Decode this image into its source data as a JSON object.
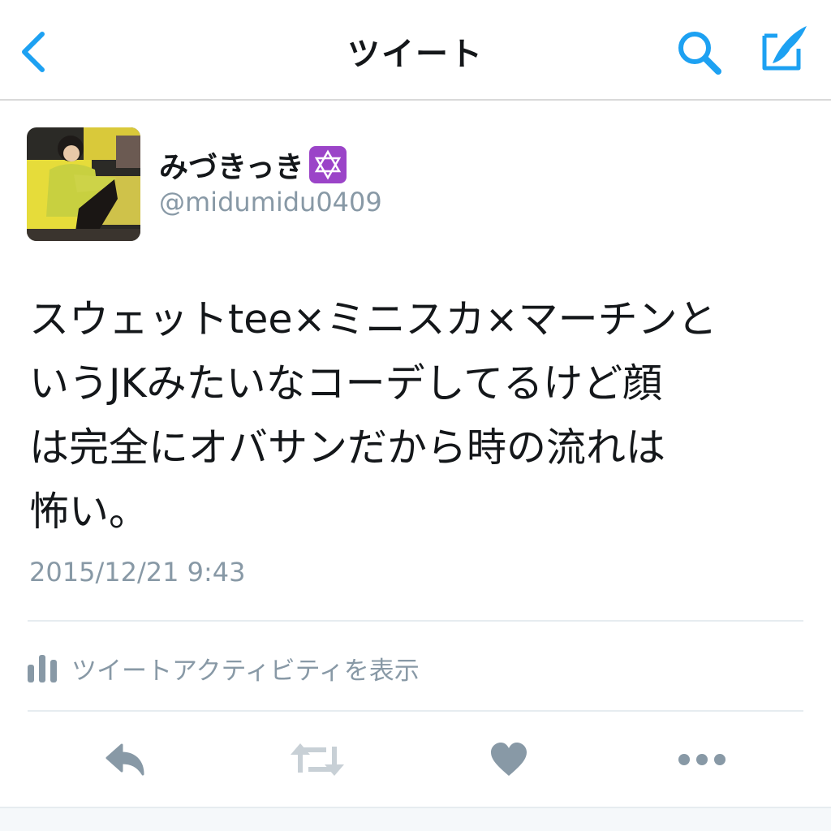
{
  "nav": {
    "title": "ツイート",
    "back_icon": "chevron-left-icon",
    "search_icon": "search-icon",
    "compose_icon": "compose-icon"
  },
  "tweet": {
    "display_name": "みづきっき",
    "name_emoji": "six-pointed-star-emoji",
    "handle": "@midumidu0409",
    "text_lines": [
      "スウェットtee×ミニスカ×マーチンと",
      "いうJKみたいなコーデしてるけど顔",
      "は完全にオバサンだから時の流れは",
      "怖い。"
    ],
    "timestamp": "2015/12/21 9:43"
  },
  "activity": {
    "label": "ツイートアクティビティを表示",
    "icon": "bar-chart-icon"
  },
  "actions": [
    "reply-icon",
    "retweet-icon",
    "like-icon",
    "more-icon"
  ],
  "colors": {
    "accent": "#1da1f2",
    "text": "#14171a",
    "secondary": "#8899a6",
    "action_icon": "#8899a6",
    "divider": "#e6ecf0"
  }
}
